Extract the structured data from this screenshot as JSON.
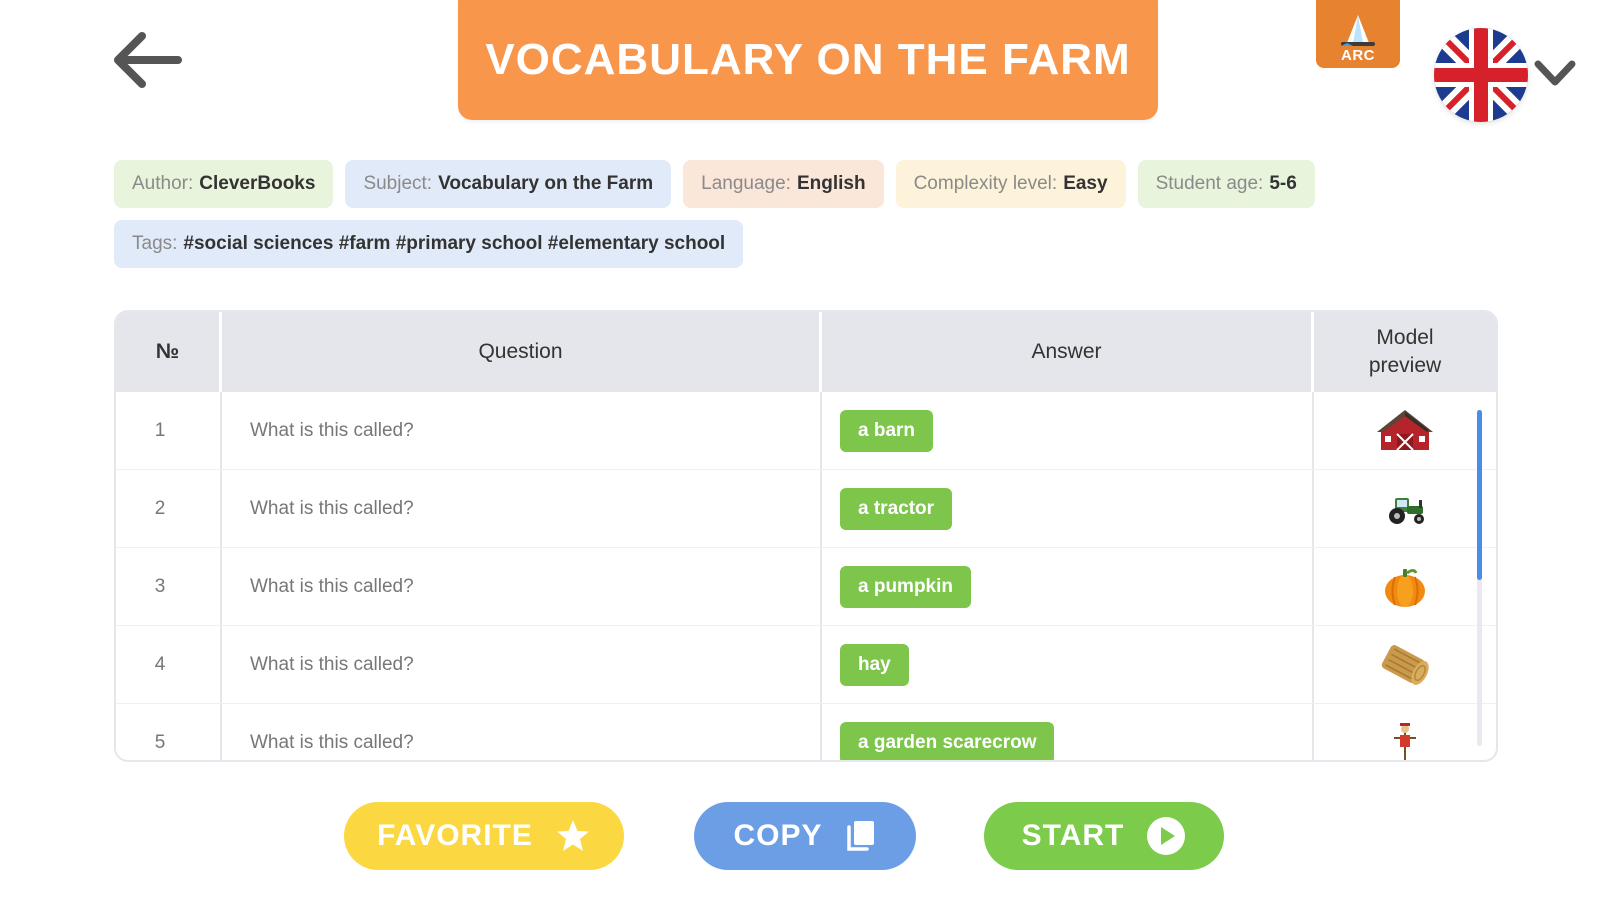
{
  "header": {
    "title": "VOCABULARY ON THE FARM",
    "arc_label": "ARC",
    "language_flag": "uk-flag-icon"
  },
  "meta": {
    "author": {
      "label": "Author:",
      "value": "CleverBooks",
      "bg": "#e8f5dc"
    },
    "subject": {
      "label": "Subject:",
      "value": "Vocabulary on the Farm",
      "bg": "#e1eaf8"
    },
    "language": {
      "label": "Language:",
      "value": "English",
      "bg": "#fbe6da"
    },
    "complexity": {
      "label": "Complexity level:",
      "value": "Easy",
      "bg": "#fdf3da"
    },
    "age": {
      "label": "Student age:",
      "value": "5-6",
      "bg": "#e8f5dc"
    },
    "tags": {
      "label": "Tags:",
      "value": "#social sciences #farm #primary school #elementary school",
      "bg": "#e1eaf8"
    }
  },
  "table": {
    "headers": {
      "num": "№",
      "question": "Question",
      "answer": "Answer",
      "model_line1": "Model",
      "model_line2": "preview"
    },
    "rows": [
      {
        "num": "1",
        "question": "What is this called?",
        "answer": "a barn",
        "model": "barn-icon"
      },
      {
        "num": "2",
        "question": "What is this called?",
        "answer": "a tractor",
        "model": "tractor-icon"
      },
      {
        "num": "3",
        "question": "What is this called?",
        "answer": "a pumpkin",
        "model": "pumpkin-icon"
      },
      {
        "num": "4",
        "question": "What is this called?",
        "answer": "hay",
        "model": "hay-bale-icon"
      },
      {
        "num": "5",
        "question": "What is this called?",
        "answer": "a garden scarecrow",
        "model": "scarecrow-icon"
      }
    ]
  },
  "actions": {
    "favorite": "FAVORITE",
    "copy": "COPY",
    "start": "START"
  },
  "colors": {
    "title_bg": "#f8964c",
    "answer_bg": "#7dc64b",
    "favorite_bg": "#fbd842",
    "copy_bg": "#6c9ee6",
    "start_bg": "#7ccb4a"
  }
}
